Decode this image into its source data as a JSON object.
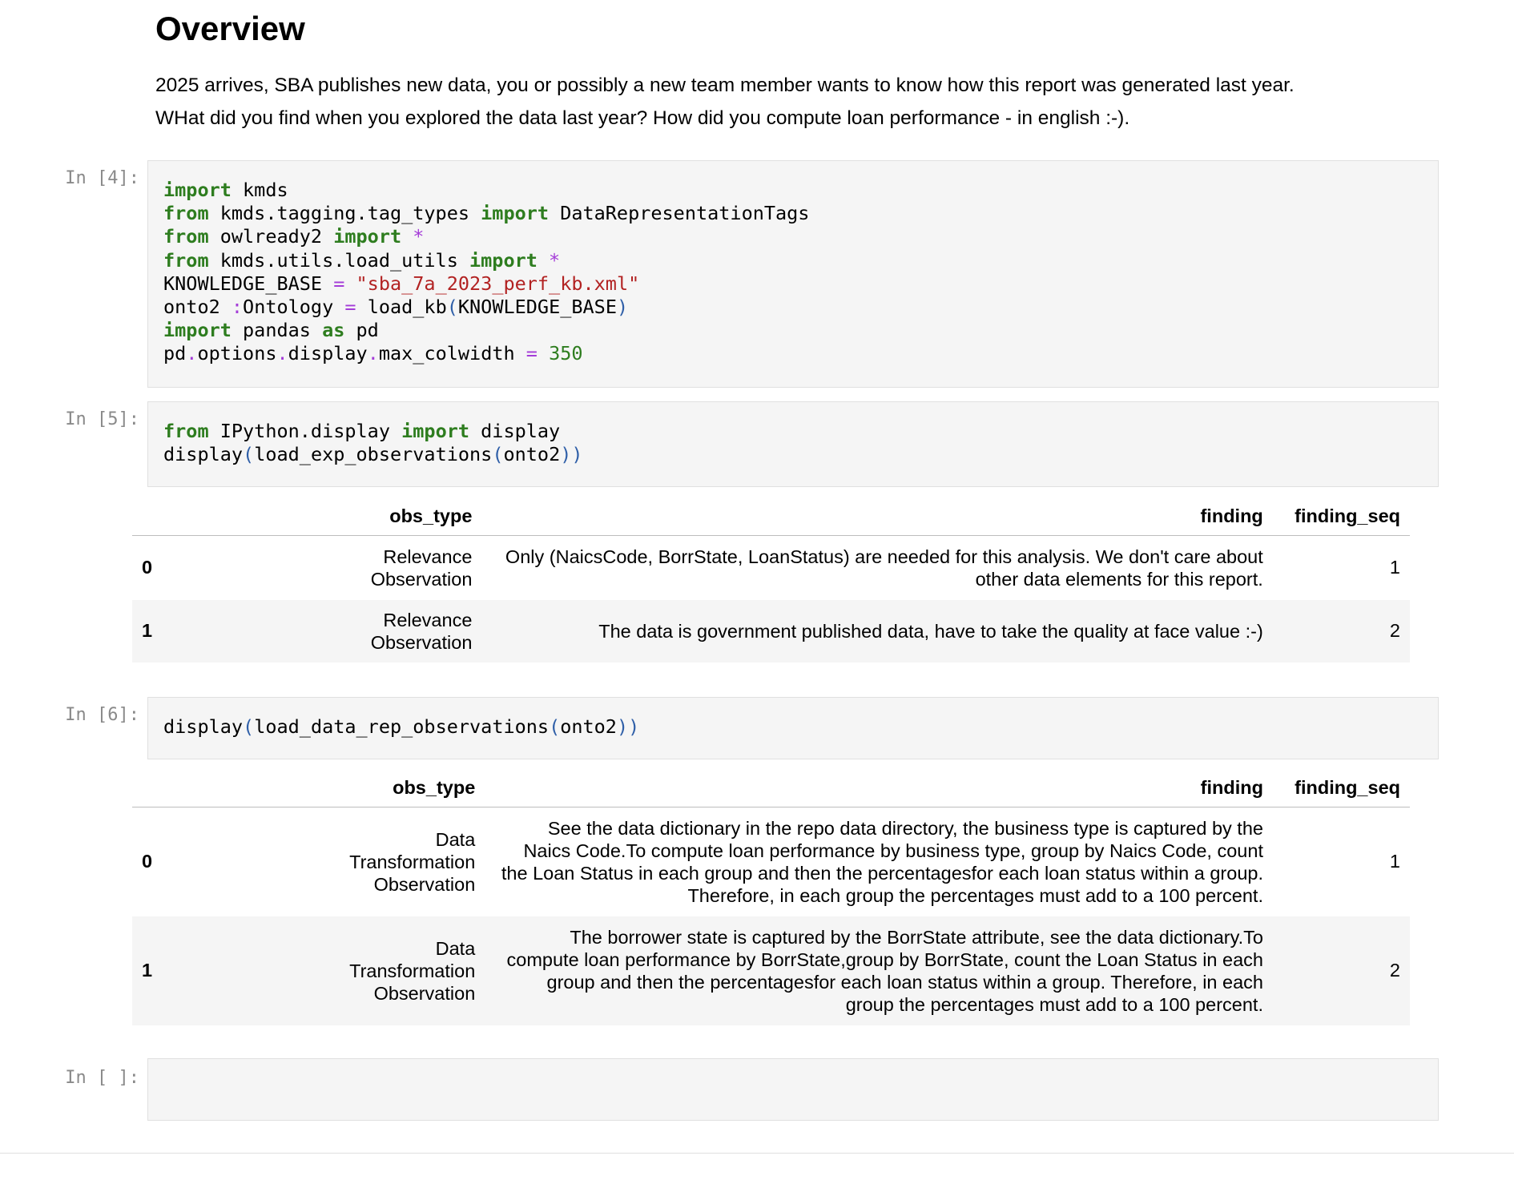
{
  "markdown": {
    "heading": "Overview",
    "para1": "2025 arrives, SBA publishes new data, you or possibly a new team member wants to know how this report was generated last year.",
    "para2": "WHat did you find when you explored the data last year? How did you compute loan performance - in english :-)."
  },
  "cells": [
    {
      "prompt": "In [4]:"
    },
    {
      "prompt": "In [5]:"
    },
    {
      "prompt": "In [6]:"
    },
    {
      "prompt": "In [ ]:"
    }
  ],
  "code": {
    "c4": {
      "l1_kw": "import",
      "l1_rest": " kmds",
      "l2_kw": "from",
      "l2_mod": " kmds.tagging.tag_types ",
      "l2_kw2": "import",
      "l2_rest": " DataRepresentationTags",
      "l3_kw": "from",
      "l3_mod": " owlready2 ",
      "l3_kw2": "import",
      "l3_op": " *",
      "l4_kw": "from",
      "l4_mod": " kmds.utils.load_utils ",
      "l4_kw2": "import",
      "l4_op": " *",
      "l5_name": "KNOWLEDGE_BASE ",
      "l5_eq": "=",
      "l5_str": " \"sba_7a_2023_perf_kb.xml\"",
      "l6_name": "onto2 ",
      "l6_colon": ":",
      "l6_type": "Ontology ",
      "l6_eq": "=",
      "l6_fn": " load_kb",
      "l6_p1": "(",
      "l6_arg": "KNOWLEDGE_BASE",
      "l6_p2": ")",
      "l7_kw": "import",
      "l7_mod": " pandas ",
      "l7_kw2": "as",
      "l7_rest": " pd",
      "l8_a": "pd",
      "l8_d1": ".",
      "l8_b": "options",
      "l8_d2": ".",
      "l8_c": "display",
      "l8_d3": ".",
      "l8_d": "max_colwidth ",
      "l8_eq": "=",
      "l8_num": " 350"
    },
    "c5": {
      "l1_kw": "from",
      "l1_mod": " IPython.display ",
      "l1_kw2": "import",
      "l1_rest": " display",
      "l2_fn": "display",
      "l2_p1": "(",
      "l2_fn2": "load_exp_observations",
      "l2_p2": "(",
      "l2_arg": "onto2",
      "l2_p3": "))"
    },
    "c6": {
      "l1_fn": "display",
      "l1_p1": "(",
      "l1_fn2": "load_data_rep_observations",
      "l1_p2": "(",
      "l1_arg": "onto2",
      "l1_p3": "))"
    }
  },
  "table1": {
    "columns": [
      "obs_type",
      "finding",
      "finding_seq"
    ],
    "rows": [
      {
        "index": "0",
        "obs_type": "Relevance Observation",
        "finding": "Only (NaicsCode, BorrState, LoanStatus) are needed for this analysis. We don't care about other data elements for this report.",
        "finding_seq": "1"
      },
      {
        "index": "1",
        "obs_type": "Relevance Observation",
        "finding": "The data is government published data, have to take the quality at face value :-)",
        "finding_seq": "2"
      }
    ]
  },
  "table2": {
    "columns": [
      "obs_type",
      "finding",
      "finding_seq"
    ],
    "rows": [
      {
        "index": "0",
        "obs_type": "Data Transformation Observation",
        "finding": "See the data dictionary in the repo data directory, the business type is captured by the Naics Code.To compute loan performance by business type, group by Naics Code, count the Loan Status in each group and then the percentagesfor each loan status within a group. Therefore, in each group the percentages must add to a 100 percent.",
        "finding_seq": "1"
      },
      {
        "index": "1",
        "obs_type": "Data Transformation Observation",
        "finding": "The borrower state is captured by the BorrState attribute, see the data dictionary.To compute loan performance by BorrState,group by BorrState, count the Loan Status in each group and then the percentagesfor each loan status within a group. Therefore, in each group the percentages must add to a 100 percent.",
        "finding_seq": "2"
      }
    ]
  },
  "colors": {
    "keyword": "#2e7d1f",
    "operator": "#a43cd8",
    "string": "#b22222",
    "paren": "#2f5fa8",
    "prompt": "#8a8a8a",
    "cell_bg": "#f5f5f5"
  }
}
